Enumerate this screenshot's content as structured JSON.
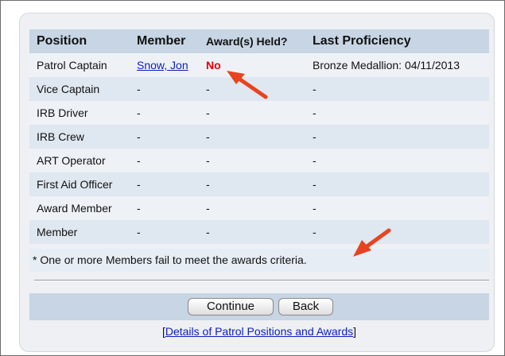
{
  "table": {
    "headers": [
      "Position",
      "Member",
      "Award(s) Held?",
      "Last Proficiency"
    ],
    "rows": [
      {
        "position": "Patrol Captain",
        "member": "Snow, Jon",
        "award": "No",
        "proficiency": "Bronze Medallion: 04/11/2013"
      },
      {
        "position": "Vice Captain",
        "member": "-",
        "award": "-",
        "proficiency": "-"
      },
      {
        "position": "IRB Driver",
        "member": "-",
        "award": "-",
        "proficiency": "-"
      },
      {
        "position": "IRB Crew",
        "member": "-",
        "award": "-",
        "proficiency": "-"
      },
      {
        "position": "ART Operator",
        "member": "-",
        "award": "-",
        "proficiency": "-"
      },
      {
        "position": "First Aid Officer",
        "member": "-",
        "award": "-",
        "proficiency": "-"
      },
      {
        "position": "Award Member",
        "member": "-",
        "award": "-",
        "proficiency": "-"
      },
      {
        "position": "Member",
        "member": "-",
        "award": "-",
        "proficiency": "-"
      }
    ]
  },
  "note": "* One or more Members fail to meet the awards criteria.",
  "buttons": {
    "continue": "Continue",
    "back": "Back"
  },
  "footer": {
    "open_bracket": "[",
    "link": "Details of Patrol Positions and Awards",
    "close_bracket": "]"
  },
  "colors": {
    "award_no": "#e10000",
    "link": "#0b1fb8",
    "arrow": "#e8431f",
    "header_bg": "#c7d5e4"
  },
  "annotations": [
    "arrow-icon",
    "arrow-icon"
  ]
}
